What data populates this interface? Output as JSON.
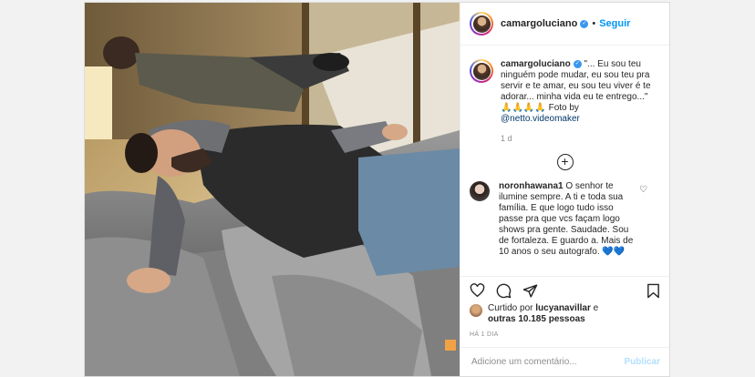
{
  "post": {
    "username": "camargoluciano",
    "follow_label": "Seguir",
    "more_icon": "more-options-icon"
  },
  "caption": {
    "username": "camargoluciano",
    "text": "\"... Eu sou teu ninguém pode mudar, eu sou teu pra servir e te amar, eu sou teu viver é te adorar... minha vida eu te entrego...\" 🙏🙏🙏🙏 Foto by",
    "mention": "@netto.videomaker",
    "age": "1 d"
  },
  "load_more_icon": "plus-circle-icon",
  "comments": [
    {
      "username": "noronhawana1",
      "text": "O senhor te ilumine sempre. A ti e toda sua família. E que logo tudo isso passe pra que vcs façam logo shows pra gente. Saudade. Sou de fortaleza. E guardo a. Mais de 10 anos o seu autografo.",
      "hearts": "💙💙"
    }
  ],
  "likes": {
    "prefix": "Curtido por",
    "user": "lucyanavillar",
    "connector": "e",
    "others": "outras 10.185 pessoas"
  },
  "timestamp": "HÁ 1 DIA",
  "add_comment": {
    "placeholder": "Adicione um comentário...",
    "publish_label": "Publicar"
  },
  "colors": {
    "link_blue": "#0095f6",
    "publish_disabled": "#b2dffc",
    "verified_blue": "#3897f0"
  }
}
